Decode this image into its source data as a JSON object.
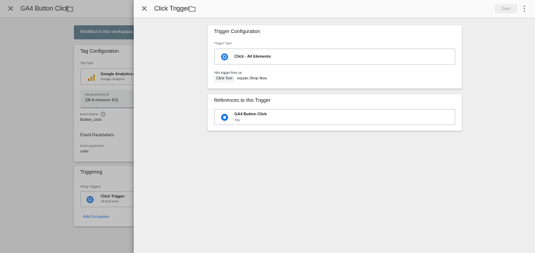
{
  "background": {
    "header": {
      "title": "GA4 Button Click"
    },
    "banner": "Modified in this workspace",
    "tag_configuration": {
      "heading": "Tag Configuration",
      "tag_type_label": "Tag Type",
      "tag_type_name": "Google Analytics: ",
      "tag_type_vendor": "Google Analytics",
      "measurement_id_label": "Measurement ID",
      "measurement_id_value": "{{B-A measure ID}}",
      "event_name_label": "Event Name",
      "event_name_value": "Button_click",
      "event_parameters_heading": "Event Parameters",
      "event_parameter_label": "Event parameter",
      "event_parameter_value": "color"
    },
    "triggering": {
      "heading": "Triggering",
      "firing_triggers_label": "Firing Triggers",
      "trigger_name": "Click Trigger",
      "trigger_sub": "All Elements",
      "add_exception": "Add Exception"
    }
  },
  "sheet": {
    "title": "Click Trigger",
    "save_label": "Save",
    "trigger_configuration": {
      "heading": "Trigger Configuration",
      "trigger_type_label": "Trigger Type",
      "trigger_type_value": "Click - All Elements",
      "fires_on_label": "This trigger fires on",
      "condition_chip": "Click Text",
      "condition_text": "equals Shop Now"
    },
    "references": {
      "heading": "References to this Trigger",
      "items": [
        {
          "name": "GA4 Button Click",
          "type": "Tag"
        }
      ]
    }
  },
  "colors": {
    "accent_blue": "#1a73e8",
    "trigger_icon_blue": "#1a73e8",
    "banner": "#5f7d8c",
    "ga_orange": "#f9ab00"
  },
  "icons": [
    "close-icon",
    "folder-icon",
    "more-vert-icon",
    "trigger-icon",
    "tag-icon",
    "help-icon",
    "google-analytics-icon"
  ]
}
